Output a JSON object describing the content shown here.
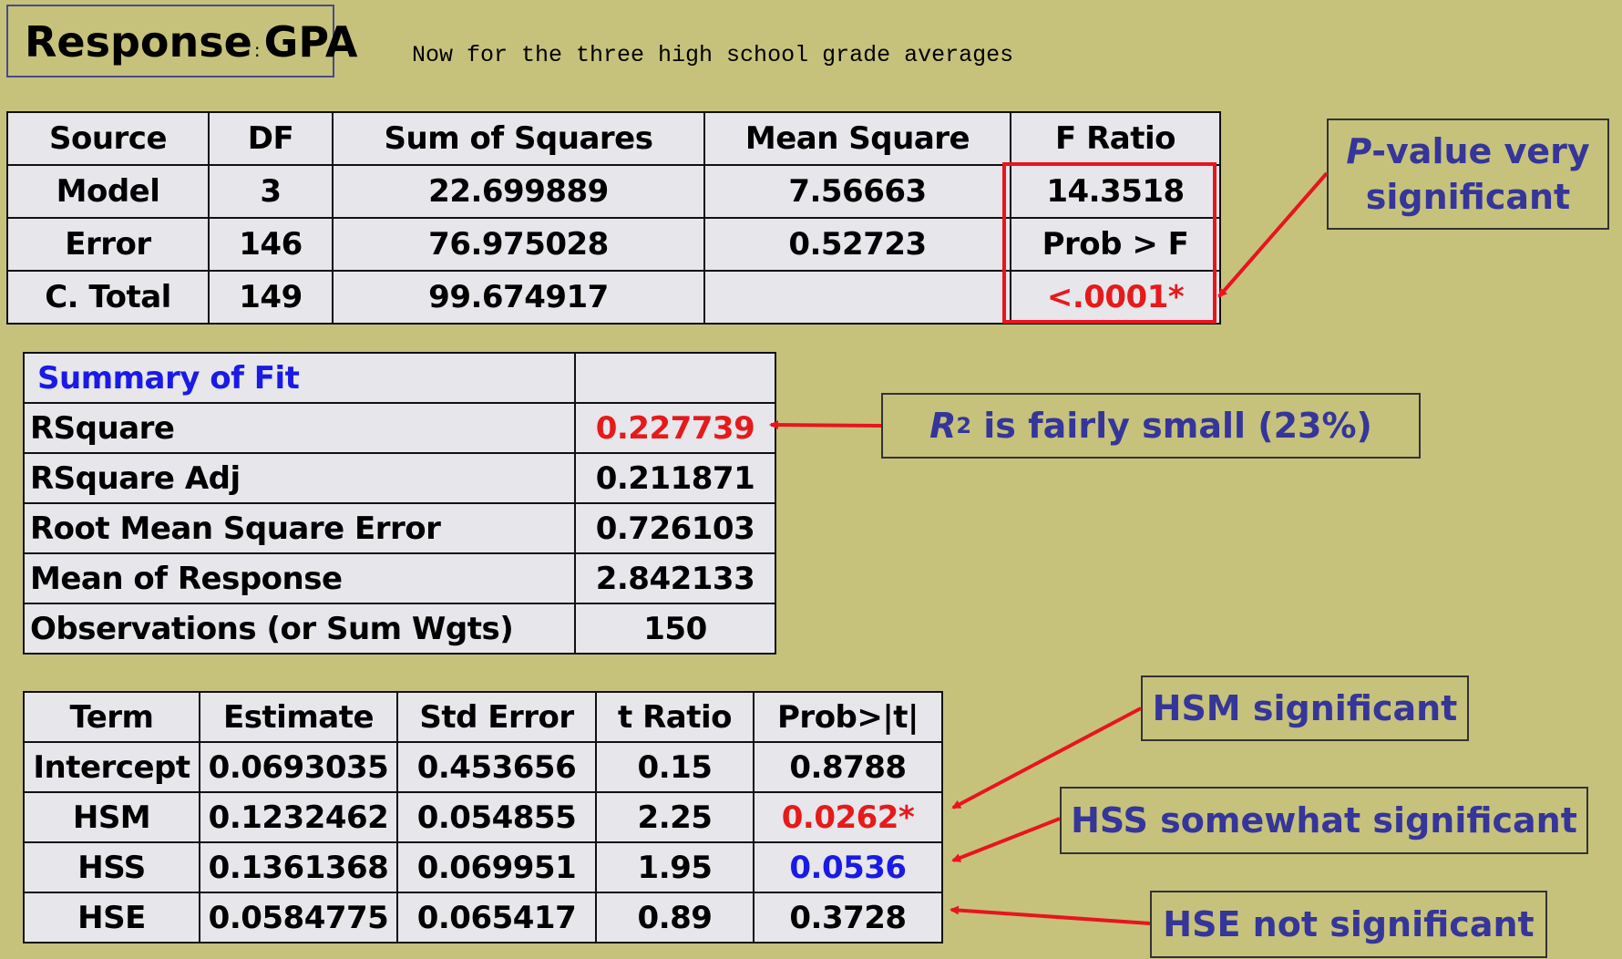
{
  "title": {
    "response_label": "Response",
    "colon": ":",
    "variable": "GPA"
  },
  "subtitle": "Now for the three high school grade averages",
  "anova": {
    "headers": [
      "Source",
      "DF",
      "Sum of Squares",
      "Mean Square",
      "F Ratio"
    ],
    "rows": [
      [
        "Model",
        "3",
        "22.699889",
        "7.56663",
        "14.3518"
      ],
      [
        "Error",
        "146",
        "76.975028",
        "0.52723",
        "Prob > F"
      ],
      [
        "C. Total",
        "149",
        "99.674917",
        "",
        "<.0001*"
      ]
    ]
  },
  "summary_of_fit": {
    "header": "Summary of Fit",
    "rows": [
      [
        "RSquare",
        "0.227739"
      ],
      [
        "RSquare Adj",
        "0.211871"
      ],
      [
        "Root Mean Square Error",
        "0.726103"
      ],
      [
        "Mean of Response",
        "2.842133"
      ],
      [
        "Observations (or Sum Wgts)",
        "150"
      ]
    ]
  },
  "parameter_estimates": {
    "headers": [
      "Term",
      "Estimate",
      "Std Error",
      "t Ratio",
      "Prob>|t|"
    ],
    "rows": [
      [
        "Intercept",
        "0.0693035",
        "0.453656",
        "0.15",
        "0.8788"
      ],
      [
        "HSM",
        "0.1232462",
        "0.054855",
        "2.25",
        "0.0262*"
      ],
      [
        "HSS",
        "0.1361368",
        "0.069951",
        "1.95",
        "0.0536"
      ],
      [
        "HSE",
        "0.0584775",
        "0.065417",
        "0.89",
        "0.3728"
      ]
    ]
  },
  "annotations": {
    "p_value_letter": "P",
    "p_value_rest_line1": "-value very",
    "p_value_line2": "significant",
    "r2_letter": "R",
    "r2_sup": "2",
    "r2_rest": " is fairly small (23%)",
    "hsm": "HSM significant",
    "hss": "HSS somewhat significant",
    "hse": "HSE not significant"
  },
  "colors": {
    "background": "#c6c27b",
    "highlight_red": "#e61a1a",
    "highlight_blue": "#1a1ae6",
    "note_text": "#35359a"
  }
}
